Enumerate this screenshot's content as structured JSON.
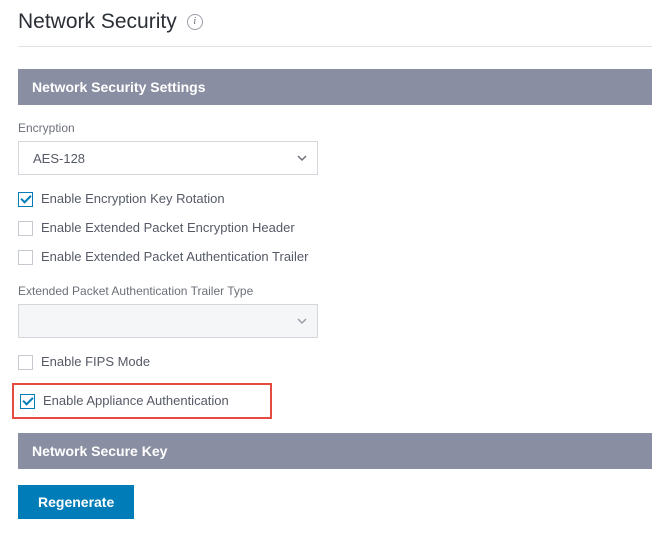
{
  "header": {
    "title": "Network Security"
  },
  "sections": {
    "settings_title": "Network Security Settings",
    "secure_key_title": "Network Secure Key"
  },
  "encryption": {
    "label": "Encryption",
    "selected": "AES-128"
  },
  "checkboxes": {
    "key_rotation": "Enable Encryption Key Rotation",
    "ext_packet_enc_header": "Enable Extended Packet Encryption Header",
    "ext_packet_auth_trailer": "Enable Extended Packet Authentication Trailer",
    "fips_mode": "Enable FIPS Mode",
    "appliance_auth": "Enable Appliance Authentication"
  },
  "trailer_type": {
    "label": "Extended Packet Authentication Trailer Type",
    "selected": ""
  },
  "buttons": {
    "regenerate": "Regenerate"
  }
}
